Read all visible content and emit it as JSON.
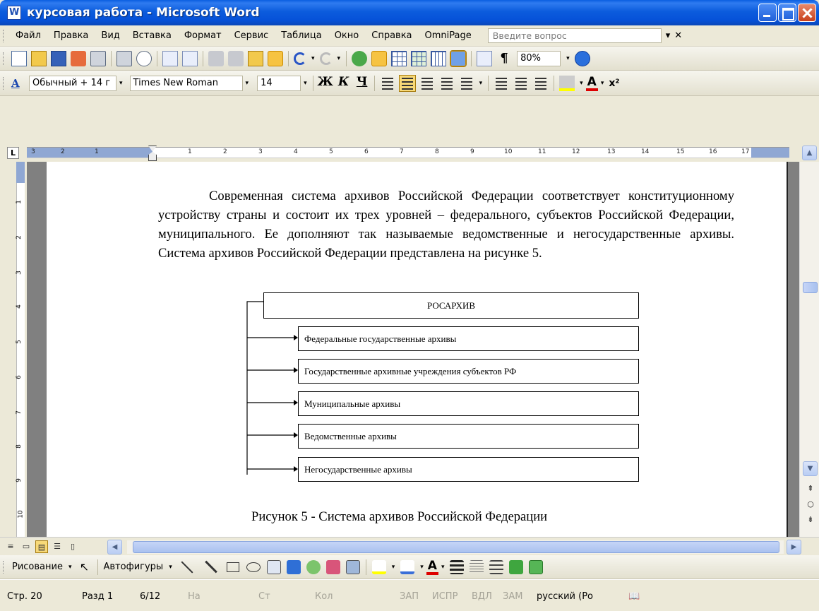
{
  "window": {
    "title": "курсовая работа - Microsoft Word"
  },
  "menu": {
    "items": [
      "Файл",
      "Правка",
      "Вид",
      "Вставка",
      "Формат",
      "Сервис",
      "Таблица",
      "Окно",
      "Справка",
      "OmniPage"
    ],
    "ask_placeholder": "Введите вопрос"
  },
  "standard_toolbar": {
    "zoom": "80%"
  },
  "formatting_toolbar": {
    "style": "Обычный + 14 г",
    "font": "Times New Roman",
    "size": "14",
    "bold": "Ж",
    "italic": "К",
    "underline": "Ч",
    "font_color_letter": "A"
  },
  "ruler": {
    "tab_selector": "L",
    "numbers": [
      "3",
      "2",
      "1",
      "1",
      "2",
      "3",
      "4",
      "5",
      "6",
      "7",
      "8",
      "9",
      "10",
      "11",
      "12",
      "13",
      "14",
      "15",
      "16",
      "17"
    ],
    "vertical_numbers": [
      "1",
      "2",
      "3",
      "4",
      "5",
      "6",
      "7",
      "8",
      "9",
      "10"
    ]
  },
  "document": {
    "paragraph": "Современная система архивов Российской Федерации соответствует конституционному устройству страны и состоит их трех уровней – федерального, субъектов Российской Федерации, муниципального. Ее дополняют так называемые ведомственные и негосударственные архивы. Система архивов Российской Федерации представлена на рисунке 5.",
    "diagram": {
      "root": "РОСАРХИВ",
      "items": [
        "Федеральные государственные архивы",
        "Государственные архивные учреждения субъектов РФ",
        "Муниципальные архивы",
        "Ведомственные архивы",
        "Негосударственные архивы"
      ]
    },
    "caption": "Рисунок 5 - Система архивов Российской Федерации"
  },
  "drawing_toolbar": {
    "drawing": "Рисование",
    "autoshapes": "Автофигуры"
  },
  "status": {
    "page": "Стр. 20",
    "section": "Разд 1",
    "pages": "6/12",
    "at": "На",
    "line": "Ст",
    "col": "Кол",
    "rec": "ЗАП",
    "trk": "ИСПР",
    "ext": "ВДЛ",
    "ovr": "ЗАМ",
    "language": "русский (Ро"
  }
}
